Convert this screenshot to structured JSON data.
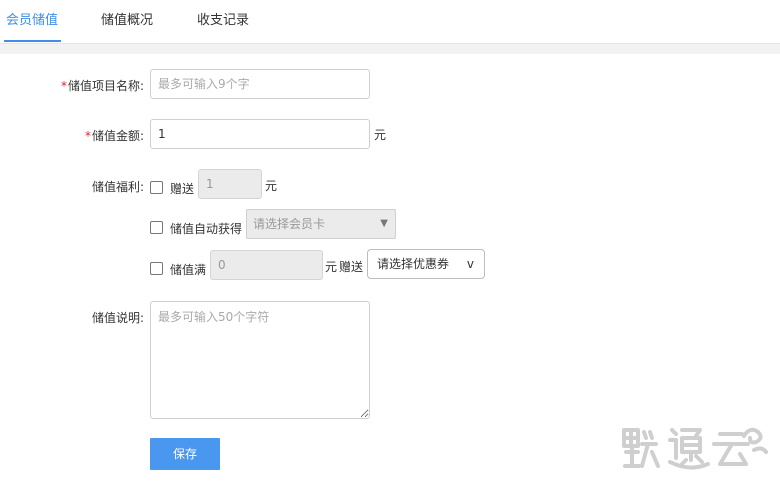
{
  "tabs": [
    {
      "label": "会员储值",
      "active": true
    },
    {
      "label": "储值概况",
      "active": false
    },
    {
      "label": "收支记录",
      "active": false
    }
  ],
  "form": {
    "required_mark": "*",
    "item_name": {
      "label": "储值项目名称:",
      "placeholder": "最多可输入9个字",
      "value": ""
    },
    "amount": {
      "label": "储值金额:",
      "value": "1",
      "unit": "元"
    },
    "benefits": {
      "label": "储值福利:",
      "gift": {
        "label": "赠送",
        "value": "1",
        "unit": "元",
        "checked": false
      },
      "auto_card": {
        "label": "储值自动获得",
        "select_value": "请选择会员卡",
        "checked": false
      },
      "threshold": {
        "label": "储值满",
        "value": "0",
        "unit": "元",
        "gift_label": "赠送",
        "coupon_value": "请选择优惠券",
        "coupon_caret": "v",
        "checked": false
      }
    },
    "description": {
      "label": "储值说明:",
      "placeholder": "最多可输入50个字符",
      "value": ""
    },
    "save_label": "保存"
  },
  "colors": {
    "accent": "#3f8ee8",
    "button": "#4a97f0",
    "required": "#e0232d"
  },
  "icons": {
    "select_caret": "chevron-down-icon",
    "watermark": "logo-watermark"
  }
}
